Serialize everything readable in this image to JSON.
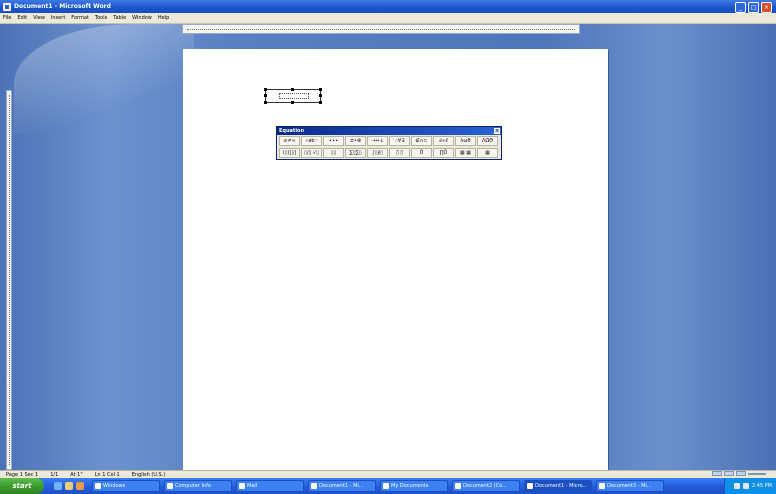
{
  "window": {
    "title": "Document1 - Microsoft Word",
    "controls": {
      "minimize": "_",
      "maximize": "□",
      "close": "×"
    }
  },
  "menu": [
    "File",
    "Edit",
    "View",
    "Insert",
    "Format",
    "Tools",
    "Table",
    "Window",
    "Help"
  ],
  "equation_toolbar": {
    "title": "Equation",
    "close": "×",
    "row1": [
      "≤≠≈",
      "∘ab∵",
      "∙∙∙",
      "±•⊗",
      "→⇔↓",
      "∴∀∃",
      "∉∩⊂",
      "∂∞ℓ",
      "λωθ",
      "ΛΩΘ"
    ],
    "row2": [
      "(▯)[▯]",
      "▯/▯ √▯",
      "▯▯",
      "∑▯∑▯",
      "∫▯∮▯",
      "▯̄ ▯⃗",
      "Ů",
      "∏Ů",
      "▦ ▦",
      "▦"
    ]
  },
  "status": [
    "Page 1 Sec 1",
    "1/1",
    "At 1\"",
    "Ln 1 Col 1",
    "English (U.S.)"
  ],
  "taskbar": {
    "start": "start",
    "tasks": [
      {
        "label": "Windows",
        "active": false
      },
      {
        "label": "Computer Info",
        "active": false
      },
      {
        "label": "Mail",
        "active": false
      },
      {
        "label": "Document1 - Mi...",
        "active": false
      },
      {
        "label": "My Documents",
        "active": false
      },
      {
        "label": "Document2 (Co...",
        "active": false
      },
      {
        "label": "Document1 - Micro...",
        "active": true
      },
      {
        "label": "Document3 - Mi...",
        "active": false
      }
    ],
    "clock": "2:45 PM",
    "quicklaunch_icons": [
      "ie-icon",
      "desktop-icon",
      "media-icon"
    ]
  }
}
